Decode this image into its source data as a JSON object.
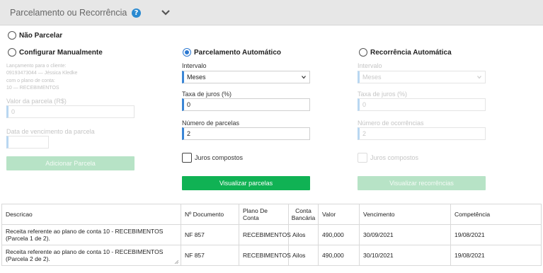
{
  "header": {
    "title": "Parcelamento ou Recorrência",
    "help_icon": "?",
    "toggle_icon": "chevron-down"
  },
  "options": {
    "nao_parcelar": "Não Parcelar",
    "manual": "Configurar Manualmente",
    "automatico": "Parcelamento Automático",
    "recorrencia": "Recorrência Automática",
    "selected": "Parcelamento Automático"
  },
  "manual": {
    "info_line1": "Lançamento para o cliente:",
    "info_line2": "09193473044 — Jéssica Kledke",
    "info_line3": "com o plano de conta:",
    "info_line4": "10 — RECEBIMENTOS",
    "valor_label": "Valor da parcela (R$)",
    "valor_value": "0",
    "data_label": "Data de vencimento da parcela",
    "data_value": "",
    "add_button": "Adicionar Parcela"
  },
  "automatico": {
    "intervalo_label": "Intervalo",
    "intervalo_value": "Meses",
    "juros_label": "Taxa de juros (%)",
    "juros_value": "0",
    "parcelas_label": "Número de parcelas",
    "parcelas_value": "2",
    "compostos_label": "Juros compostos",
    "button": "Visualizar parcelas"
  },
  "recorrencia": {
    "intervalo_label": "Intervalo",
    "intervalo_value": "Meses",
    "juros_label": "Taxa de juros (%)",
    "juros_value": "0",
    "ocorrencias_label": "Número de ocorrências",
    "ocorrencias_value": "2",
    "compostos_label": "Juros compostos",
    "button": "Visualizar recorrências"
  },
  "table": {
    "headers": {
      "descricao": "Descricao",
      "documento": "Nº Documento",
      "plano": "Plano De Conta",
      "conta_line1": "Conta",
      "conta_line2": "Bancária",
      "valor": "Valor",
      "vencimento": "Vencimento",
      "competencia": "Competência"
    },
    "rows": [
      {
        "descricao_line1": "Receita referente ao plano de conta 10 - RECEBIMENTOS",
        "descricao_line2": "(Parcela 1 de 2).",
        "documento": "NF 857",
        "plano": "RECEBIMENTOS",
        "conta": "Ailos",
        "valor": "490,000",
        "vencimento": "30/09/2021",
        "competencia": "19/08/2021"
      },
      {
        "descricao_line1": "Receita referente ao plano de conta 10 - RECEBIMENTOS",
        "descricao_line2": "(Parcela 2 de 2).",
        "documento": "NF 857",
        "plano": "RECEBIMENTOS",
        "conta": "Ailos",
        "valor": "490,000",
        "vencimento": "30/10/2021",
        "competencia": "19/08/2021"
      }
    ]
  },
  "colors": {
    "accent": "#2b78d1",
    "primary_button": "#10b254",
    "disabled_button": "#b7e3c6",
    "header_bg": "#e7e7e7"
  }
}
